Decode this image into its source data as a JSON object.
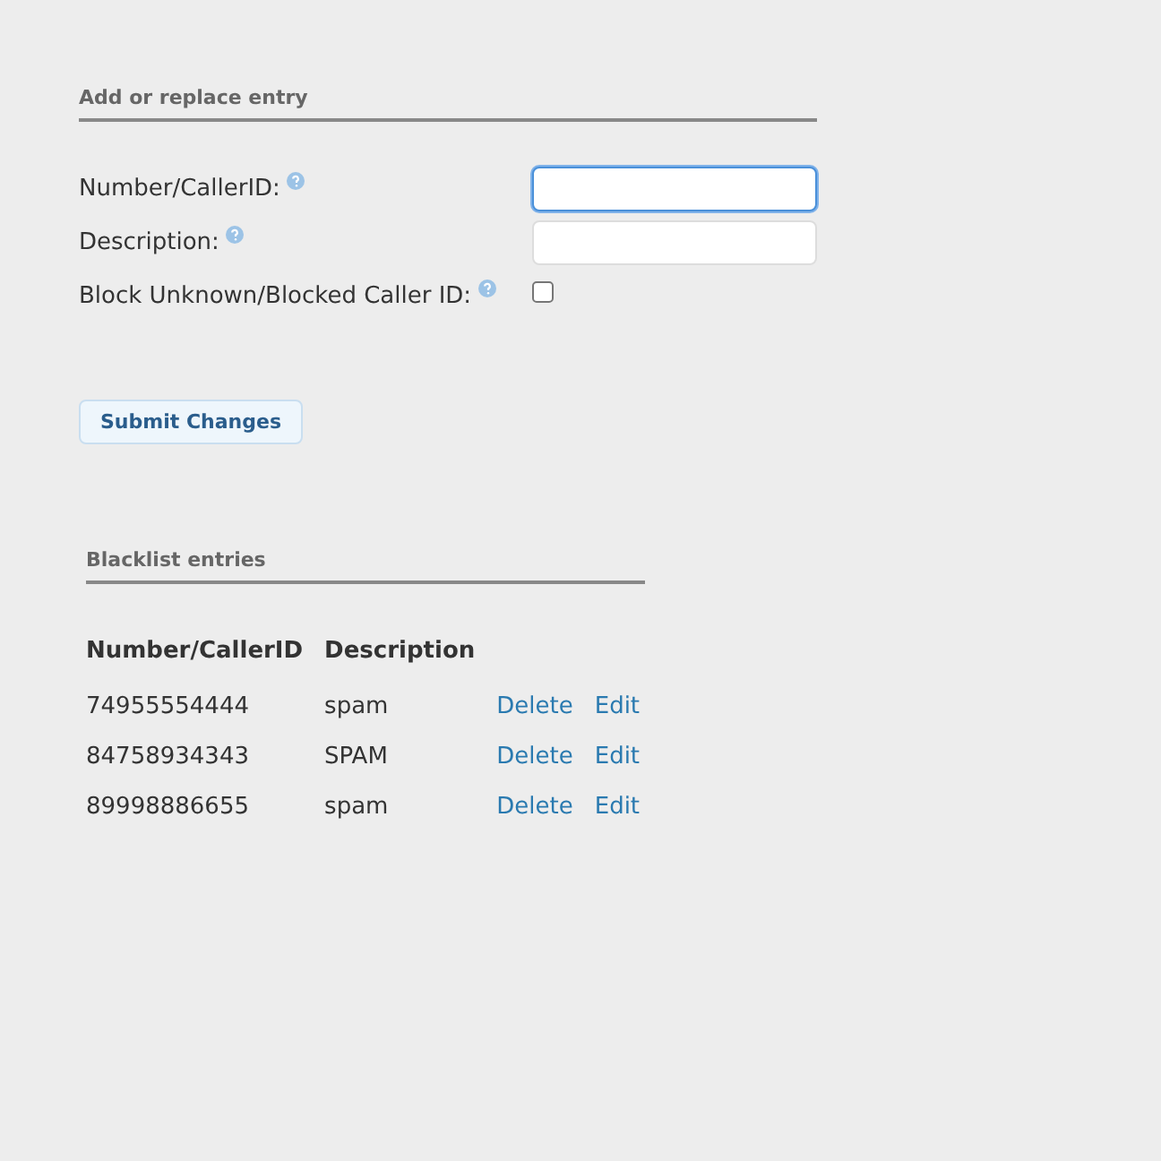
{
  "entry_form": {
    "title": "Add or replace entry",
    "fields": [
      {
        "kind": "text",
        "label": "Number/CallerID:",
        "focused": true
      },
      {
        "kind": "text",
        "label": "Description:",
        "focused": false
      },
      {
        "kind": "checkbox",
        "label": "Block Unknown/Blocked Caller ID:",
        "checked": false
      }
    ],
    "submit_button": "Submit Changes"
  },
  "blacklist": {
    "title": "Blacklist entries",
    "columns": [
      "Number/CallerID",
      "Description"
    ],
    "rows": [
      {
        "number": "74955554444",
        "description": "spam",
        "actions": [
          "Delete",
          "Edit"
        ]
      },
      {
        "number": "84758934343",
        "description": "SPAM",
        "actions": [
          "Delete",
          "Edit"
        ]
      },
      {
        "number": "89998886655",
        "description": "spam",
        "actions": [
          "Delete",
          "Edit"
        ]
      }
    ]
  }
}
